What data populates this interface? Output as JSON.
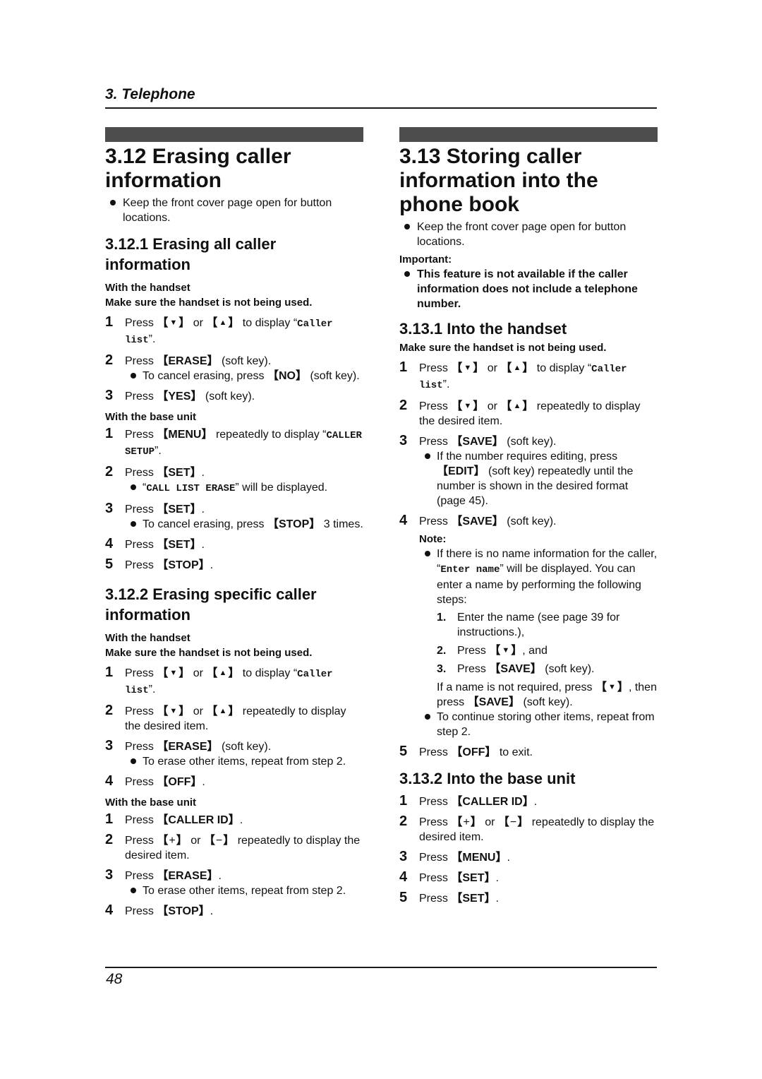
{
  "header": {
    "chapter": "3. Telephone"
  },
  "footer": {
    "page_number": "48"
  },
  "left": {
    "title": "3.12 Erasing caller information",
    "intro_bullet": "Keep the front cover page open for button locations.",
    "sec1": {
      "title": "3.12.1 Erasing all caller information",
      "handset_label": "With the handset",
      "handset_note": "Make sure the handset is not being used.",
      "handset_steps": [
        {
          "num": "1",
          "pre": "Press",
          "key1": "▼",
          "mid": "or",
          "key2": "▲",
          "post": "to display",
          "mono": "Caller list",
          "end": "."
        },
        {
          "num": "2",
          "pre": "Press",
          "key": "ERASE",
          "post": "(soft key).",
          "sub_pre": "To cancel erasing, press",
          "sub_key": "NO",
          "sub_post": "(soft key)."
        },
        {
          "num": "3",
          "pre": "Press",
          "key": "YES",
          "post": "(soft key)."
        }
      ],
      "base_label": "With the base unit",
      "base_steps": [
        {
          "num": "1",
          "pre": "Press",
          "key": "MENU",
          "post": "repeatedly to display",
          "mono": "CALLER SETUP",
          "end": "."
        },
        {
          "num": "2",
          "pre": "Press",
          "key": "SET",
          "post": ".",
          "sub_mono": "CALL LIST ERASE",
          "sub_post": "will be displayed."
        },
        {
          "num": "3",
          "pre": "Press",
          "key": "SET",
          "post": ".",
          "sub_pre": "To cancel erasing, press",
          "sub_key": "STOP",
          "sub_post": "3 times."
        },
        {
          "num": "4",
          "pre": "Press",
          "key": "SET",
          "post": "."
        },
        {
          "num": "5",
          "pre": "Press",
          "key": "STOP",
          "post": "."
        }
      ]
    },
    "sec2": {
      "title": "3.12.2 Erasing specific caller information",
      "handset_label": "With the handset",
      "handset_note": "Make sure the handset is not being used.",
      "handset_steps": [
        {
          "num": "1",
          "pre": "Press",
          "key1": "▼",
          "mid": "or",
          "key2": "▲",
          "post": "to display",
          "mono": "Caller list",
          "end": "."
        },
        {
          "num": "2",
          "pre": "Press",
          "key1": "▼",
          "mid": "or",
          "key2": "▲",
          "post": "repeatedly to display the desired item."
        },
        {
          "num": "3",
          "pre": "Press",
          "key": "ERASE",
          "post": "(soft key).",
          "sub": "To erase other items, repeat from step 2."
        },
        {
          "num": "4",
          "pre": "Press",
          "key": "OFF",
          "post": "."
        }
      ],
      "base_label": "With the base unit",
      "base_steps": [
        {
          "num": "1",
          "pre": "Press",
          "key": "CALLER ID",
          "post": "."
        },
        {
          "num": "2",
          "pre": "Press",
          "key1": "+",
          "mid": "or",
          "key2": "−",
          "post": "repeatedly to display the desired item."
        },
        {
          "num": "3",
          "pre": "Press",
          "key": "ERASE",
          "post": ".",
          "sub": "To erase other items, repeat from step 2."
        },
        {
          "num": "4",
          "pre": "Press",
          "key": "STOP",
          "post": "."
        }
      ]
    }
  },
  "right": {
    "title": "3.13 Storing caller information into the phone book",
    "intro_bullet": "Keep the front cover page open for button locations.",
    "important_label": "Important:",
    "important_bullet": "This feature is not available if the caller information does not include a telephone number.",
    "sec1": {
      "title": "3.13.1 Into the handset",
      "handset_note": "Make sure the handset is not being used.",
      "steps": [
        {
          "num": "1",
          "pre": "Press",
          "key1": "▼",
          "mid": "or",
          "key2": "▲",
          "post": "to display",
          "mono": "Caller list",
          "end": "."
        },
        {
          "num": "2",
          "pre": "Press",
          "key1": "▼",
          "mid": "or",
          "key2": "▲",
          "post": "repeatedly to display the desired item."
        },
        {
          "num": "3",
          "pre": "Press",
          "key": "SAVE",
          "post": "(soft key).",
          "sub_pre": "If the number requires editing, press",
          "sub_key": "EDIT",
          "sub_post": "(soft key) repeatedly until the number is shown in the desired format (page 45)."
        },
        {
          "num": "4",
          "pre": "Press",
          "key": "SAVE",
          "post": "(soft key)."
        },
        {
          "num": "5",
          "pre": "Press",
          "key": "OFF",
          "post": "to exit."
        }
      ],
      "note_label": "Note:",
      "note_bullet_pre": "If there is no name information for the caller,",
      "note_bullet_mono": "Enter name",
      "note_bullet_post": "will be displayed. You can enter a name by performing the following steps:",
      "note_steps": [
        {
          "num": "1.",
          "text": "Enter the name (see page 39 for instructions.),"
        },
        {
          "num": "2.",
          "pre": "Press",
          "key": "▼",
          "post": ", and"
        },
        {
          "num": "3.",
          "pre": "Press",
          "key": "SAVE",
          "post": "(soft key)."
        }
      ],
      "no_name_pre": "If a name is not required, press",
      "no_name_key1": "▼",
      "no_name_mid": ", then press",
      "no_name_key2": "SAVE",
      "no_name_post": "(soft key).",
      "continue_bullet": "To continue storing other items, repeat from step 2."
    },
    "sec2": {
      "title": "3.13.2 Into the base unit",
      "steps": [
        {
          "num": "1",
          "pre": "Press",
          "key": "CALLER ID",
          "post": "."
        },
        {
          "num": "2",
          "pre": "Press",
          "key1": "+",
          "mid": "or",
          "key2": "−",
          "post": "repeatedly to display the desired item."
        },
        {
          "num": "3",
          "pre": "Press",
          "key": "MENU",
          "post": "."
        },
        {
          "num": "4",
          "pre": "Press",
          "key": "SET",
          "post": "."
        },
        {
          "num": "5",
          "pre": "Press",
          "key": "SET",
          "post": "."
        }
      ]
    }
  }
}
